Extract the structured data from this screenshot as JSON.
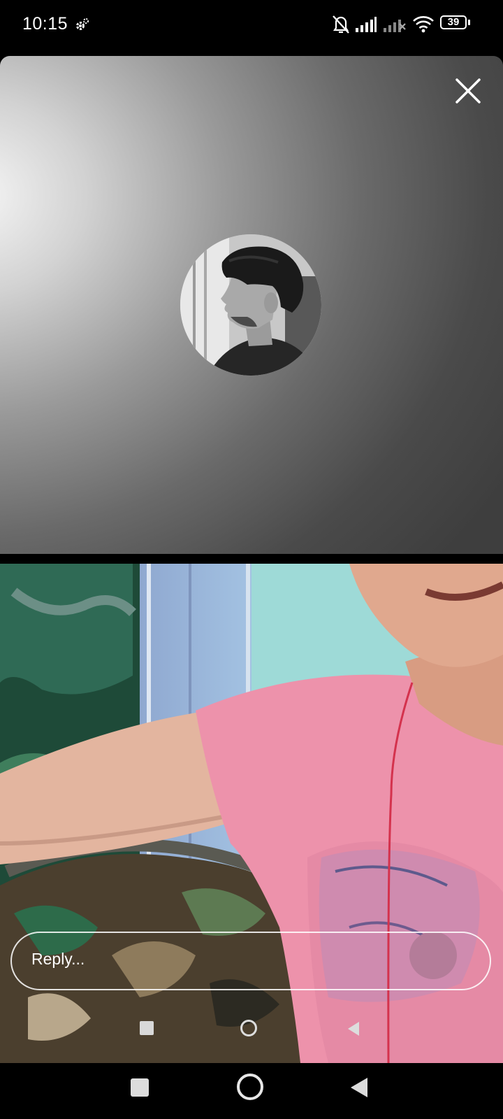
{
  "status_bar": {
    "time": "10:15",
    "battery": "39",
    "icons": [
      "settings-gear-icon",
      "notifications-muted-icon",
      "signal-icon",
      "no-signal-icon",
      "wifi-icon",
      "battery-icon"
    ]
  },
  "video_call": {
    "close_icon": "close-icon",
    "remote_avatar": "avatar",
    "reply_placeholder": "Reply..."
  },
  "navigation": {
    "buttons": [
      "recents-button",
      "home-button",
      "back-button"
    ]
  }
}
